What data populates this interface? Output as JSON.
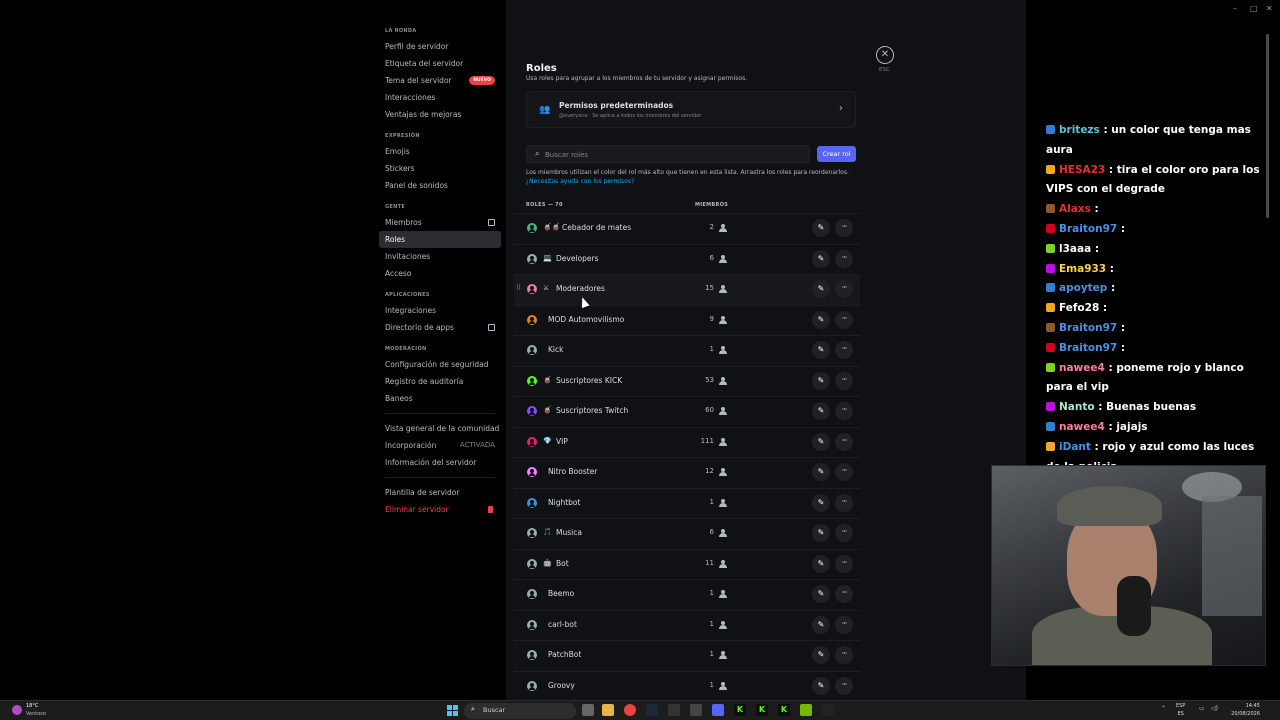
{
  "window_controls": {
    "minimize": "–",
    "maximize": "□",
    "close": "✕"
  },
  "sidebar": {
    "sections": [
      {
        "heading": "LA RONDA",
        "items": [
          {
            "label": "Perfil de servidor"
          },
          {
            "label": "Etiqueta del servidor"
          },
          {
            "label": "Tema del servidor",
            "badge": "NUEVO"
          },
          {
            "label": "Interacciones"
          },
          {
            "label": "Ventajas de mejoras"
          }
        ]
      },
      {
        "heading": "EXPRESIÓN",
        "items": [
          {
            "label": "Emojis"
          },
          {
            "label": "Stickers"
          },
          {
            "label": "Panel de sonidos"
          }
        ]
      },
      {
        "heading": "GENTE",
        "items": [
          {
            "label": "Miembros"
          },
          {
            "label": "Roles"
          },
          {
            "label": "Invitaciones"
          },
          {
            "label": "Acceso"
          }
        ]
      },
      {
        "heading": "APLICACIONES",
        "items": [
          {
            "label": "Integraciones"
          },
          {
            "label": "Directorio de apps"
          }
        ]
      },
      {
        "heading": "MODERACIÓN",
        "items": [
          {
            "label": "Configuración de seguridad"
          },
          {
            "label": "Registro de auditoría"
          },
          {
            "label": "Baneos"
          }
        ]
      }
    ],
    "extra": {
      "community_overview": "Vista general de la comunidad",
      "onboarding": "Incorporación",
      "onboarding_status": "ACTIVADA",
      "server_info": "Información del servidor",
      "server_template": "Plantilla de servidor",
      "delete_server": "Eliminar servidor"
    }
  },
  "main": {
    "esc_label": "ESC",
    "close_glyph": "✕",
    "title": "Roles",
    "subtitle": "Usa roles para agrupar a los miembros de tu servidor y asignar permisos.",
    "default_perms": {
      "title": "Permisos predeterminados",
      "subtitle": "@everyone · Se aplica a todos los miembros del servidor"
    },
    "search_placeholder": "Buscar roles",
    "create_role": "Crear rol",
    "info_text": "Los miembros utilizan el color del rol más alto que tienen en esta lista. Arrastra los roles para reordenarlos.",
    "help_link": "¿Necesitas ayuda con los permisos?",
    "col_roles": "ROLES — 70",
    "col_members": "MIEMBROS",
    "roles": [
      {
        "name": "Cebador de mates",
        "emoji": "🧉🧉",
        "count": "2",
        "color": "#43b581"
      },
      {
        "name": "Developers",
        "emoji": "💻",
        "count": "6",
        "color": "#99aab5"
      },
      {
        "name": "Moderadores",
        "emoji": "⚔",
        "count": "15",
        "color": "#e67e9e"
      },
      {
        "name": "MOD Automovilismo",
        "emoji": "",
        "count": "9",
        "color": "#e67e22"
      },
      {
        "name": "Kick",
        "emoji": "",
        "count": "1",
        "color": "#99aab5"
      },
      {
        "name": "Suscriptores KICK",
        "emoji": "🧉",
        "count": "53",
        "color": "#53fc18"
      },
      {
        "name": "Suscriptores Twitch",
        "emoji": "🧉",
        "count": "60",
        "color": "#9146ff"
      },
      {
        "name": "VIP",
        "emoji": "💎",
        "count": "111",
        "color": "#e91e63"
      },
      {
        "name": "Nitro Booster",
        "emoji": "",
        "count": "12",
        "color": "#f47fff"
      },
      {
        "name": "Nightbot",
        "emoji": "",
        "count": "1",
        "color": "#3498db"
      },
      {
        "name": "Musica",
        "emoji": "🎵",
        "count": "6",
        "color": "#99aab5"
      },
      {
        "name": "Bot",
        "emoji": "🤖",
        "count": "11",
        "color": "#99aab5"
      },
      {
        "name": "Beemo",
        "emoji": "",
        "count": "1",
        "color": "#99aab5"
      },
      {
        "name": "carl-bot",
        "emoji": "",
        "count": "1",
        "color": "#99aab5"
      },
      {
        "name": "PatchBot",
        "emoji": "",
        "count": "1",
        "color": "#99aab5"
      },
      {
        "name": "Groovy",
        "emoji": "",
        "count": "1",
        "color": "#99aab5"
      }
    ]
  },
  "chat": [
    {
      "user": "britezs",
      "color": "#5dc3d9",
      "text": " : un color que tenga mas aura"
    },
    {
      "user": "HESA23",
      "color": "#e4302b",
      "text": " : tira el color oro para los VIPS con el degrade"
    },
    {
      "user": "Alaxs",
      "color": "#e4302b",
      "text": " : "
    },
    {
      "user": "Braiton97",
      "color": "#4a90e2",
      "text": " : "
    },
    {
      "user": "l3aaa",
      "color": "#ffffff",
      "text": " : "
    },
    {
      "user": "Ema933",
      "color": "#ffd24a",
      "text": " : "
    },
    {
      "user": "apoytep",
      "color": "#4a90e2",
      "text": " : "
    },
    {
      "user": "Fefo28",
      "color": "#ffffff",
      "text": " : "
    },
    {
      "user": "Braiton97",
      "color": "#4a90e2",
      "text": " : "
    },
    {
      "user": "Braiton97",
      "color": "#4a90e2",
      "text": " : "
    },
    {
      "user": "nawee4",
      "color": "#ff7aa8",
      "text": " : poneme rojo y blanco para el vip"
    },
    {
      "user": "Nanto",
      "color": "#a8e6cf",
      "text": " : Buenas buenas"
    },
    {
      "user": "nawee4",
      "color": "#ff7aa8",
      "text": " : jajajs"
    },
    {
      "user": "iDant",
      "color": "#4a90e2",
      "text": " : rojo y azul como las luces de la policia"
    }
  ],
  "taskbar": {
    "weather_temp": "18°C",
    "weather_cond": "Ventoso",
    "search_label": "Buscar",
    "lang_top": "ESP",
    "lang_bottom": "ES",
    "time": "14:45",
    "date": "20/08/2026",
    "apps": [
      "K",
      "K",
      "K"
    ]
  }
}
